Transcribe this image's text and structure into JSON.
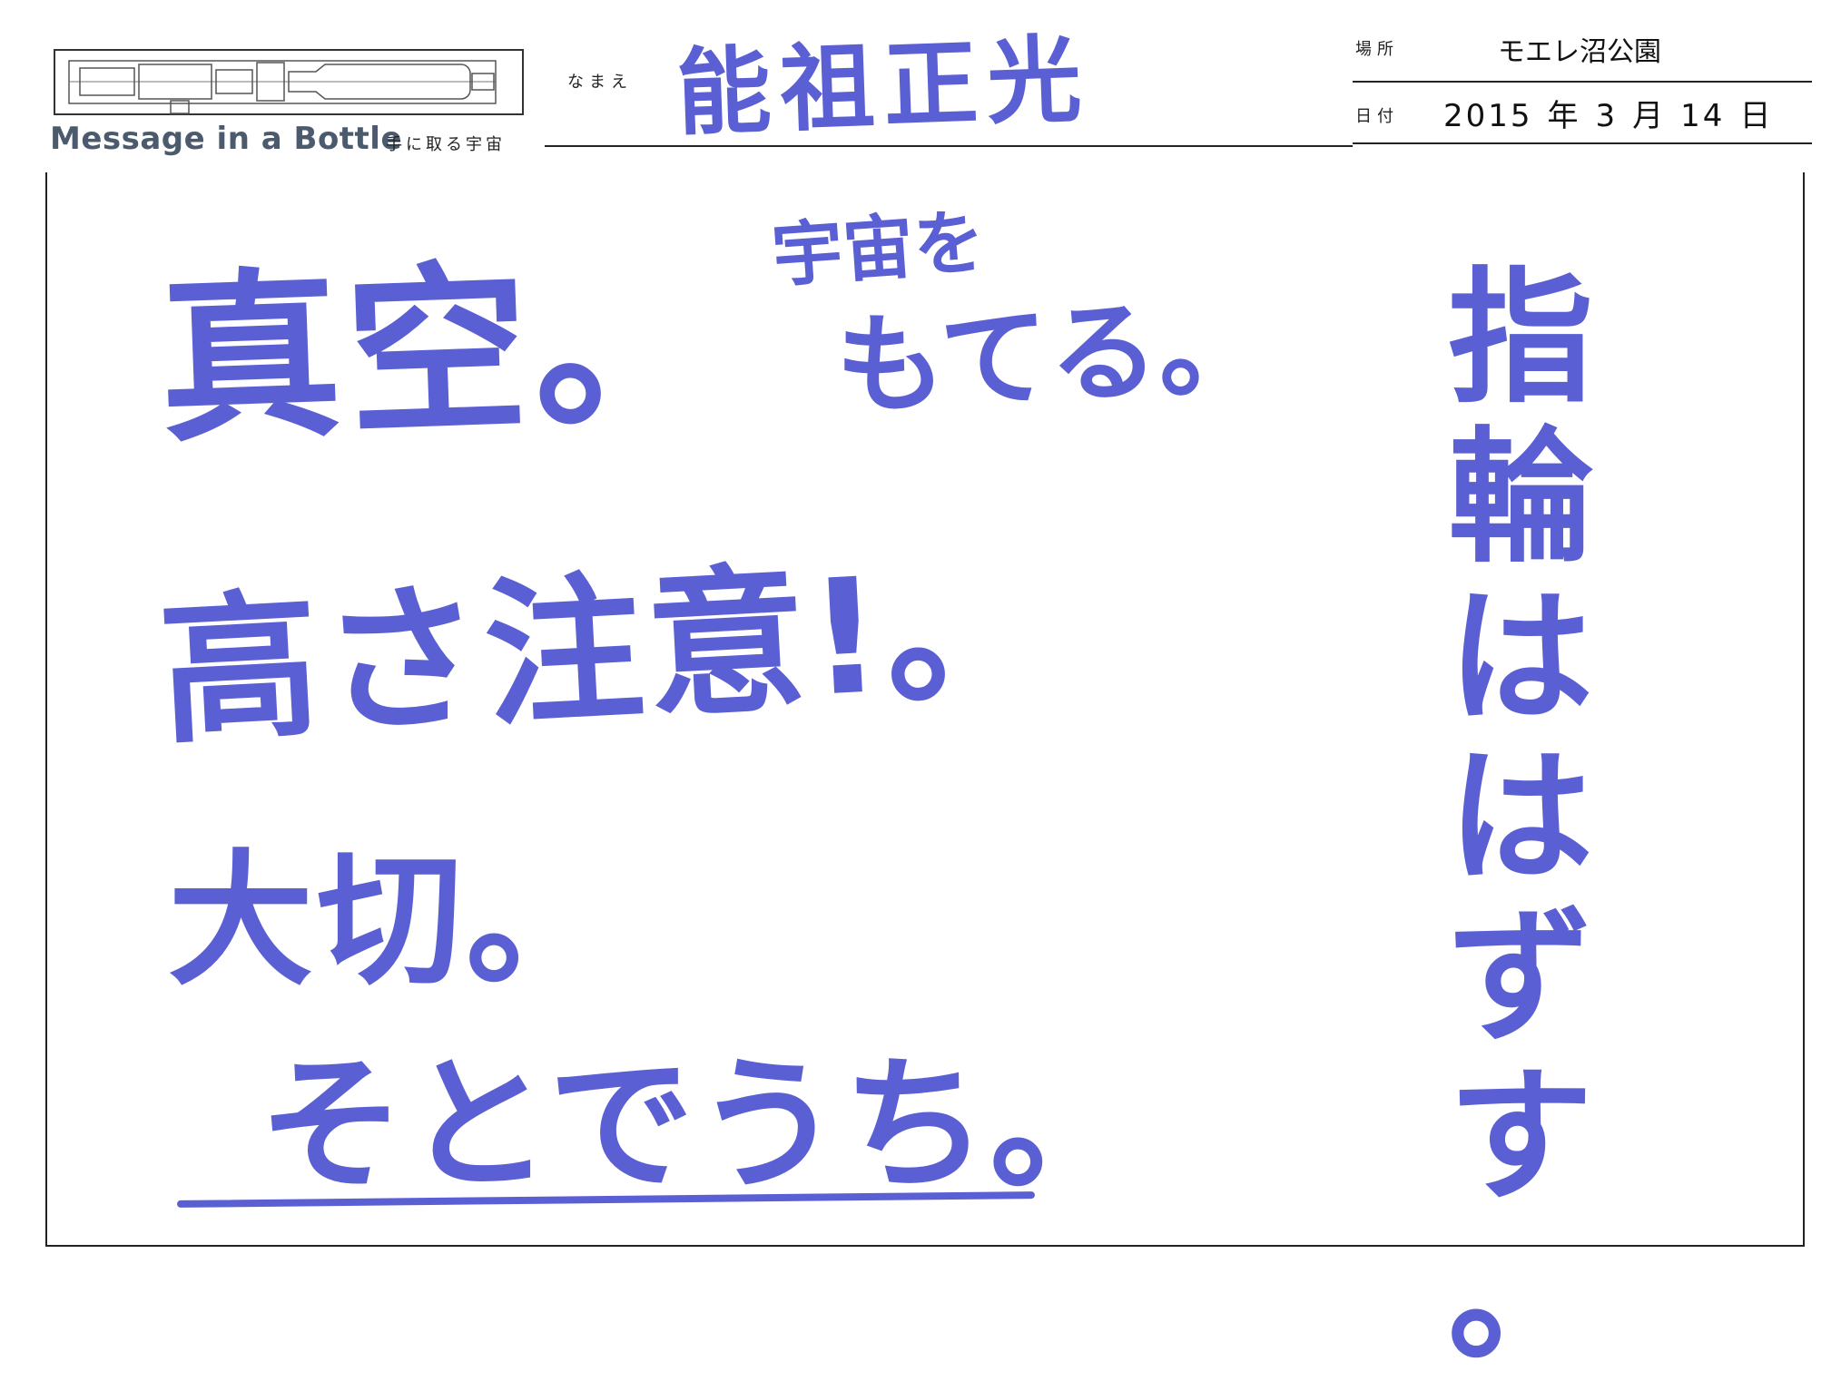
{
  "header": {
    "brand": "Message in a Bottle",
    "tagline": "手に取る宇宙",
    "name_label": "なまえ",
    "name_value": "能祖正光",
    "place_label": "場所",
    "place_value": "モエレ沼公園",
    "date_label": "日付",
    "date": {
      "year": "2015",
      "year_unit": "年",
      "month": "3",
      "month_unit": "月",
      "day": "14",
      "day_unit": "日"
    }
  },
  "message": {
    "line1": "真空。",
    "line_small_a": "宇宙を",
    "line_small_b": "もてる。",
    "line2": "高さ注意!。",
    "line3": "大切。",
    "line4": "そとでうち。",
    "vertical": [
      "指",
      "輪",
      "は",
      "は",
      "ず",
      "す",
      "。"
    ]
  },
  "colors": {
    "ink": "#5b5fd4",
    "brand": "#4c5a6e"
  }
}
